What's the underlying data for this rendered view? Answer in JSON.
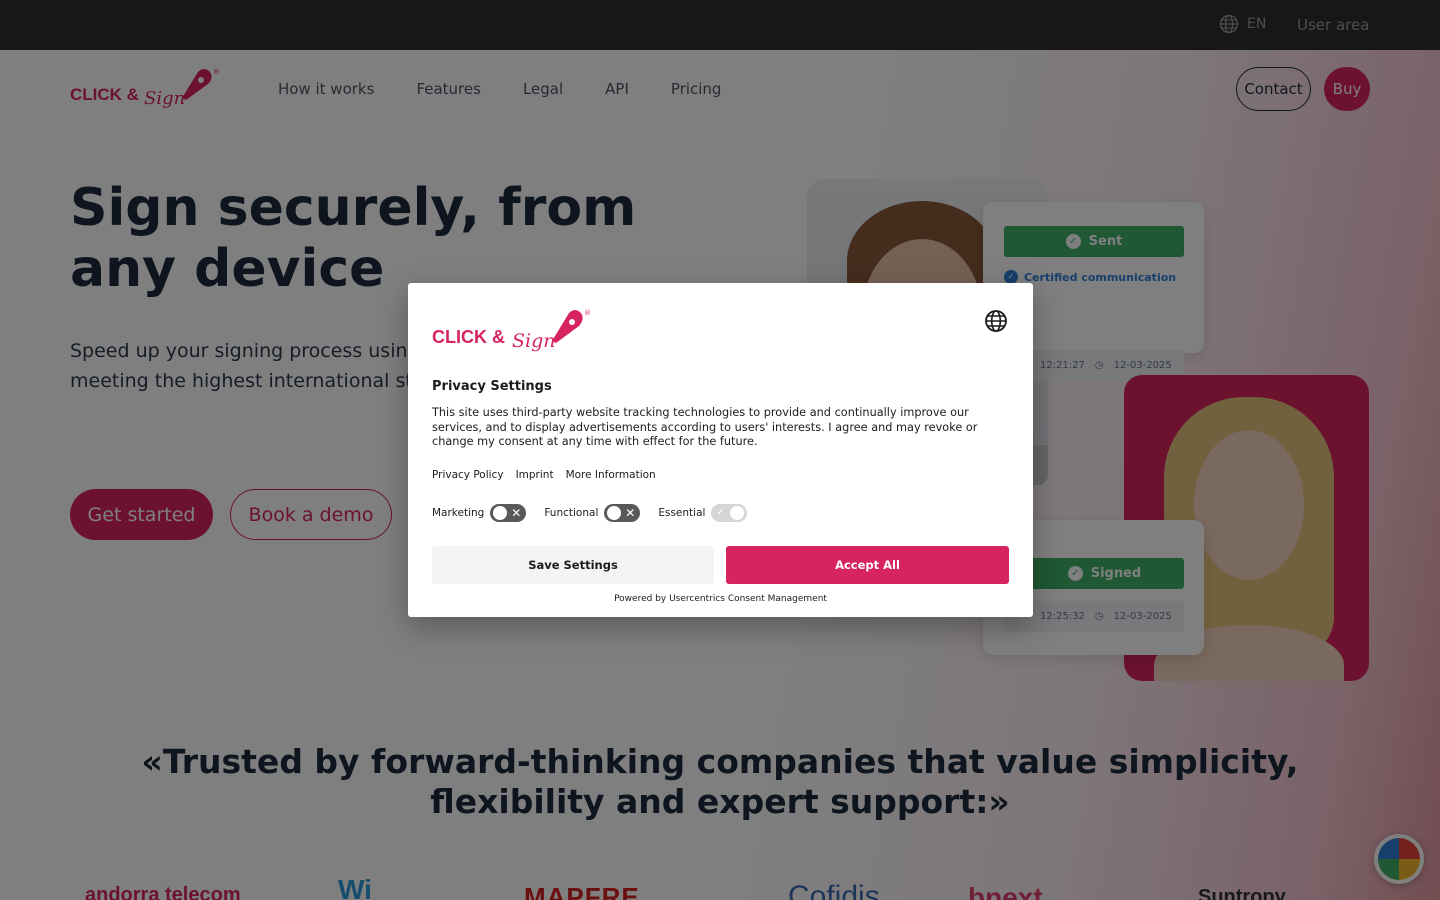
{
  "topbar": {
    "lang": "EN",
    "user_area": "User area"
  },
  "brand": {
    "logo_word": "CLICK &",
    "logo_script": "Sign",
    "reg": "®"
  },
  "nav": {
    "items": [
      "How it works",
      "Features",
      "Legal",
      "API",
      "Pricing"
    ]
  },
  "header": {
    "contact": "Contact",
    "buy": "Buy"
  },
  "hero": {
    "title": "Sign securely, from any device",
    "subtitle": "Speed up your signing process using SMS, while meeting the highest international standards.",
    "cta_primary": "Get started",
    "cta_secondary": "Book a demo"
  },
  "illustration": {
    "sent": "Sent",
    "certified": "Certified communication",
    "time1": "12:21:27",
    "date1": "12-03-2025",
    "signed": "Signed",
    "time2": "12:25:32",
    "date2": "12-03-2025"
  },
  "trusted": {
    "heading": "«Trusted by forward-thinking companies that value simplicity, flexibility and expert support:»"
  },
  "companies": [
    "andorra telecom",
    "Wi",
    "MAPFRE",
    "Cofidis",
    "bnext",
    "Suntropy"
  ],
  "consent": {
    "title": "Privacy Settings",
    "text": "This site uses third-party website tracking technologies to provide and continually improve our services, and to display advertisements according to users' interests. I agree and may revoke or change my consent at any time with effect for the future.",
    "links": [
      "Privacy Policy",
      "Imprint",
      "More Information"
    ],
    "toggles": [
      {
        "label": "Marketing",
        "state": "off"
      },
      {
        "label": "Functional",
        "state": "off"
      },
      {
        "label": "Essential",
        "state": "on-disabled"
      }
    ],
    "save": "Save Settings",
    "accept": "Accept All",
    "powered": "Powered by Usercentrics Consent Management"
  },
  "colors": {
    "brand": "#d8245e",
    "success": "#3fb067",
    "topbar": "#2f2f31"
  }
}
